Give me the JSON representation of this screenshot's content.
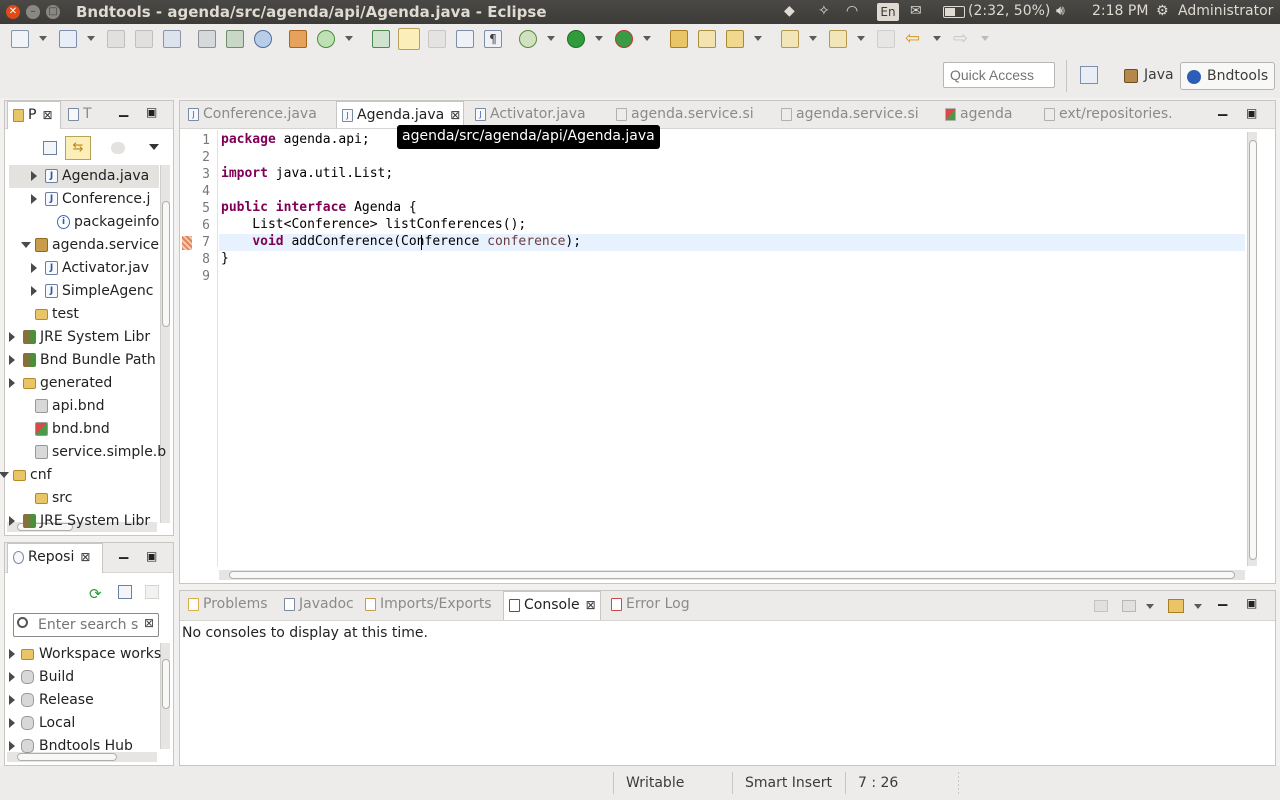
{
  "topbar": {
    "window_title": "Bndtools - agenda/src/agenda/api/Agenda.java - Eclipse",
    "keyboard": "En",
    "battery": "(2:32, 50%)",
    "time": "2:18 PM",
    "user": "Administrator"
  },
  "toolbar": {
    "quick_access_placeholder": "Quick Access",
    "perspectives": [
      "Java",
      "Bndtools"
    ]
  },
  "package_explorer": {
    "tabs": [
      "P",
      "T"
    ],
    "items": [
      {
        "label": "Agenda.java",
        "icon": "java-file-icon",
        "expand": "collapsed"
      },
      {
        "label": "Conference.j",
        "icon": "java-file-icon",
        "expand": "collapsed"
      },
      {
        "label": "packageinfo",
        "icon": "info-icon",
        "expand": "none"
      },
      {
        "label": "agenda.service",
        "icon": "package-icon",
        "expand": "expanded"
      },
      {
        "label": "Activator.jav",
        "icon": "java-file-icon",
        "expand": "collapsed"
      },
      {
        "label": "SimpleAgenc",
        "icon": "java-file-icon",
        "expand": "collapsed"
      },
      {
        "label": "test",
        "icon": "source-folder-icon",
        "expand": "none"
      },
      {
        "label": "JRE System Libr",
        "icon": "library-icon",
        "expand": "collapsed"
      },
      {
        "label": "Bnd Bundle Path",
        "icon": "library-icon",
        "expand": "collapsed"
      },
      {
        "label": "generated",
        "icon": "folder-icon",
        "expand": "collapsed"
      },
      {
        "label": "api.bnd",
        "icon": "bnd-file-icon",
        "expand": "none"
      },
      {
        "label": "bnd.bnd",
        "icon": "bnd-bundle-icon",
        "expand": "none"
      },
      {
        "label": "service.simple.b",
        "icon": "bnd-file-icon",
        "expand": "none"
      },
      {
        "label": "cnf",
        "icon": "project-icon",
        "expand": "expanded"
      },
      {
        "label": "src",
        "icon": "source-folder-icon",
        "expand": "none"
      },
      {
        "label": "JRE System Libr",
        "icon": "library-icon",
        "expand": "collapsed"
      }
    ]
  },
  "repositories": {
    "tab": "Reposi",
    "search_placeholder": "Enter search st",
    "items": [
      "Workspace works",
      "Build",
      "Release",
      "Local",
      "Bndtools Hub"
    ]
  },
  "editor": {
    "tabs": [
      "Conference.java",
      "Agenda.java",
      "Activator.java",
      "agenda.service.si",
      "agenda.service.si",
      "agenda",
      "ext/repositories."
    ],
    "active_tab": "Agenda.java",
    "tooltip": "agenda/src/agenda/api/Agenda.java",
    "line_numbers": [
      "1",
      "2",
      "3",
      "4",
      "5",
      "6",
      "7",
      "8",
      "9"
    ],
    "code": {
      "l1_kw": "package",
      "l1_rest": " agenda.api;",
      "l3_kw": "import",
      "l3_rest": " java.util.List;",
      "l5_kw1": "public",
      "l5_kw2": "interface",
      "l5_rest": " Agenda {",
      "l6": "    List<Conference> listConferences();",
      "l7_indent": "    ",
      "l7_kw": "void",
      "l7_mid": " addConference(Conference ",
      "l7_param": "conference",
      "l7_end": ");",
      "l8": "}"
    }
  },
  "bottom_panel": {
    "tabs": [
      "Problems",
      "Javadoc",
      "Imports/Exports",
      "Console",
      "Error Log"
    ],
    "active_tab": "Console",
    "message": "No consoles to display at this time."
  },
  "status": {
    "writable": "Writable",
    "insert_mode": "Smart Insert",
    "position": "7 : 26"
  },
  "colors": {
    "keyword": "#7f0055",
    "parameter": "#6a3e3e",
    "current_line": "#e8f2fe",
    "titlebar": "#3c3b37"
  }
}
